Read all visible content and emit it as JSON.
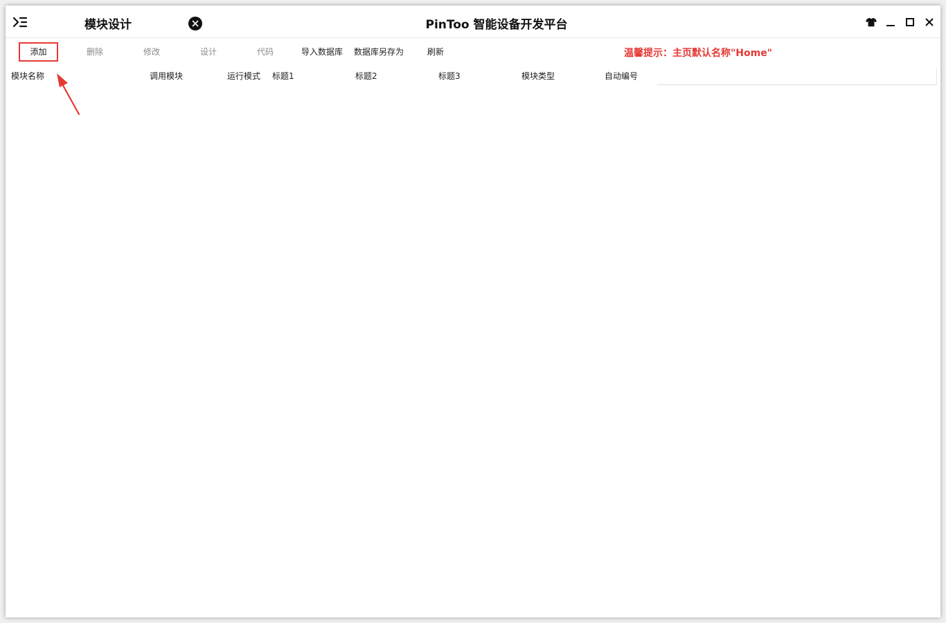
{
  "titlebar": {
    "module_title": "模块设计",
    "app_title": "PinToo 智能设备开发平台",
    "icons": {
      "menu": "menu-expand-icon",
      "close_tab": "close-circle-icon",
      "skin": "tshirt-icon",
      "minimize": "minimize-icon",
      "maximize": "maximize-icon",
      "close": "close-icon"
    }
  },
  "toolbar": {
    "add": "添加",
    "delete": "删除",
    "modify": "修改",
    "design": "设计",
    "code": "代码",
    "import_db": "导入数据库",
    "save_db_as": "数据库另存为",
    "refresh": "刷新"
  },
  "hint": {
    "text": "温馨提示：主页默认名称\"Home\"",
    "color": "#e53935"
  },
  "grid": {
    "columns": [
      "模块名称",
      "调用模块",
      "运行模式",
      "标题1",
      "标题2",
      "标题3",
      "模块类型",
      "自动编号"
    ],
    "rows": []
  },
  "colors": {
    "highlight": "#e53935",
    "disabled_text": "#8a8a8a"
  }
}
